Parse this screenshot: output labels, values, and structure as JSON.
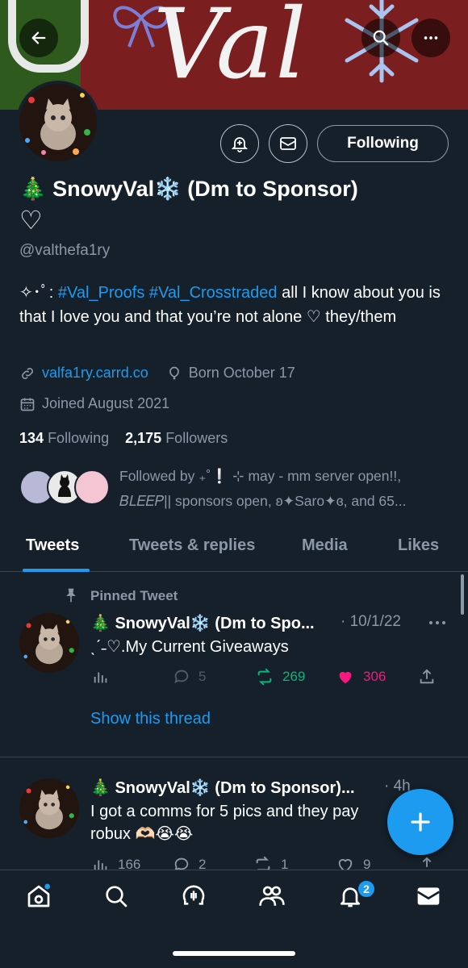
{
  "banner": {
    "word": "Val"
  },
  "profile": {
    "name": "🎄 SnowyVal❄️ (Dm to Sponsor)",
    "name_suffix": "♡",
    "handle": "@valthefa1ry",
    "bio_prefix": "✧･ﾟ: ",
    "bio_tags": "#Val_Proofs #Val_Crosstraded",
    "bio_text": " all I know about you is that I love you and that you’re not alone ♡ they/them",
    "link": "valfa1ry.carrd.co",
    "birthday": "Born October 17",
    "joined": "Joined August 2021",
    "following_count": "134",
    "following_label": "Following",
    "followers_count": "2,175",
    "followers_label": "Followers",
    "follow_button": "Following",
    "followed_by": "Followed by ₊˚❕ ⊹ may - mm server open!!, 𝐵𝐿𝐸𝐸𝑃|| sponsors open, ʚ✦Saro✦ɞ, and 65..."
  },
  "tabs": [
    "Tweets",
    "Tweets & replies",
    "Media",
    "Likes"
  ],
  "pinned_label": "Pinned Tweet",
  "tweets": [
    {
      "name": "🎄 SnowyVal❄️ (Dm to Spo...",
      "date": "· 10/1/22",
      "text": "ˎˊ˗♡.My Current Giveaways",
      "replies": "5",
      "retweets": "269",
      "likes": "306",
      "thread_link": "Show this thread"
    },
    {
      "name": "🎄 SnowyVal❄️ (Dm to Sponsor)...",
      "date": "· 4h",
      "text": "I got a comms for 5 pics and they pay robux 🫶🏻😭😭",
      "views": "166",
      "replies": "2",
      "retweets": "1",
      "likes": "9"
    }
  ],
  "nav": {
    "notifications_badge": "2"
  },
  "colors": {
    "accent": "#1d9bf0",
    "background": "#15202b",
    "like": "#f91880",
    "retweet": "#00ba7c"
  }
}
